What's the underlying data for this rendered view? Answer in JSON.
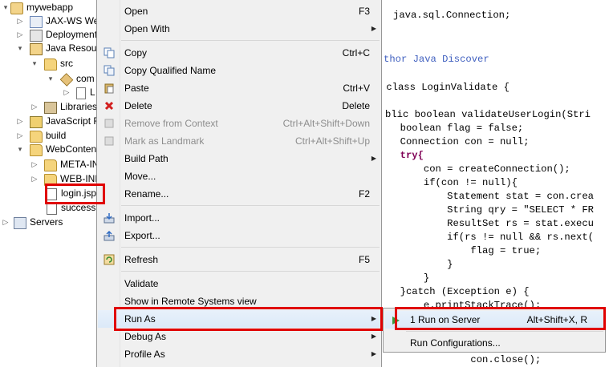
{
  "explorer": {
    "items": [
      {
        "label": "mywebapp",
        "icon": "project-icon",
        "arrow": "▾"
      },
      {
        "label": "JAX-WS We",
        "icon": "jaxws-icon",
        "arrow": "▷"
      },
      {
        "label": "Deployment",
        "icon": "deployment-icon",
        "arrow": "▷"
      },
      {
        "label": "Java Resour",
        "icon": "java-resources-icon",
        "arrow": "▾"
      },
      {
        "label": "src",
        "icon": "source-folder-icon",
        "arrow": "▾"
      },
      {
        "label": "com",
        "icon": "package-icon",
        "arrow": "▾"
      },
      {
        "label": "L",
        "icon": "java-file-icon",
        "arrow": "▷"
      },
      {
        "label": "Libraries",
        "icon": "libraries-icon",
        "arrow": "▷"
      },
      {
        "label": "JavaScript R",
        "icon": "javascript-resources-icon",
        "arrow": "▷"
      },
      {
        "label": "build",
        "icon": "folder-icon",
        "arrow": "▷"
      },
      {
        "label": "WebContent",
        "icon": "folder-icon",
        "arrow": "▾"
      },
      {
        "label": "META-IN",
        "icon": "folder-icon",
        "arrow": "▷"
      },
      {
        "label": "WEB-INF",
        "icon": "folder-icon",
        "arrow": "▷"
      },
      {
        "label": "login.jsp",
        "icon": "jsp-file-icon",
        "arrow": ""
      },
      {
        "label": "success.",
        "icon": "jsp-file-icon",
        "arrow": ""
      },
      {
        "label": "Servers",
        "icon": "servers-folder-icon",
        "arrow": "▷"
      }
    ]
  },
  "context_menu": {
    "items": [
      {
        "label": "Open",
        "shortcut": "F3"
      },
      {
        "label": "Open With",
        "submenu": "▶"
      },
      {
        "label": "Copy",
        "shortcut": "Ctrl+C",
        "icon": "copy-icon"
      },
      {
        "label": "Copy Qualified Name",
        "icon": "copy-qualified-icon"
      },
      {
        "label": "Paste",
        "shortcut": "Ctrl+V",
        "icon": "paste-icon"
      },
      {
        "label": "Delete",
        "shortcut": "Delete",
        "icon": "delete-icon"
      },
      {
        "label": "Remove from Context",
        "shortcut": "Ctrl+Alt+Shift+Down",
        "icon": "remove-context-icon"
      },
      {
        "label": "Mark as Landmark",
        "shortcut": "Ctrl+Alt+Shift+Up",
        "icon": "landmark-icon"
      },
      {
        "label": "Build Path",
        "submenu": "▶"
      },
      {
        "label": "Move..."
      },
      {
        "label": "Rename...",
        "shortcut": "F2"
      },
      {
        "label": "Import...",
        "icon": "import-icon"
      },
      {
        "label": "Export...",
        "icon": "export-icon"
      },
      {
        "label": "Refresh",
        "shortcut": "F5",
        "icon": "refresh-icon"
      },
      {
        "label": "Validate"
      },
      {
        "label": "Show in Remote Systems view"
      },
      {
        "label": "Run As",
        "submenu": "▶"
      },
      {
        "label": "Debug As",
        "submenu": "▶"
      },
      {
        "label": "Profile As",
        "submenu": "▶"
      }
    ]
  },
  "run_as_submenu": {
    "items": [
      {
        "label": "1 Run on Server",
        "shortcut": "Alt+Shift+X, R"
      },
      {
        "label": "Run Configurations..."
      }
    ]
  },
  "editor": {
    "lines": [
      "java.sql.Connection;",
      "thor Java Discover",
      " class LoginValidate {",
      "blic boolean validateUserLogin(Stri",
      "  boolean flag = false;",
      "  Connection con = null;",
      "  try{",
      "      con = createConnection();",
      "      if(con != null){",
      "          Statement stat = con.crea",
      "          String qry = \"SELECT * FR",
      "          ResultSet rs = stat.execu",
      "          if(rs != null && rs.next(",
      "              flag = true;",
      "          }",
      "      }",
      "  }catch (Exception e) {",
      "      e.printStackTrace();",
      "",
      "",
      "",
      "              con.close();"
    ]
  },
  "colors": {
    "highlight_red": "#e00000",
    "menu_bg": "#f0f0f0",
    "keyword": "#7f0055",
    "string": "#2a00ff",
    "comment": "#3f5fbf"
  }
}
